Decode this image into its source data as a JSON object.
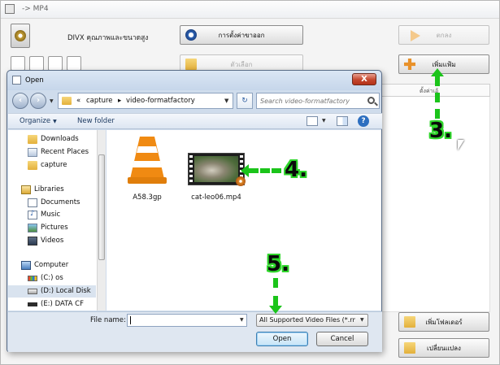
{
  "app": {
    "title": "-> MP4",
    "format_label": "DIVX คุณภาพและขนาดสูง",
    "buttons": {
      "output_settings": "การตั้งค่าขาออก",
      "ok": "ตกลง",
      "options": "ตัวเลือก",
      "add_file": "เพิ่มแฟ้ม",
      "add_folder": "เพิ่มโฟลเดอร์",
      "convert": "เปลี่ยนแปลง"
    },
    "list_header": "ตั้งค่าเอ้"
  },
  "dialog": {
    "title": "Open",
    "close_glyph": "X",
    "address": {
      "prefix": "«",
      "crumbs": [
        "capture",
        "video-formatfactory"
      ],
      "separator": "▸"
    },
    "search_placeholder": "Search video-formatfactory",
    "toolbar": {
      "organize": "Organize",
      "new_folder": "New folder"
    },
    "nav": [
      {
        "label": "Downloads",
        "icon": "folder-icon"
      },
      {
        "label": "Recent Places",
        "icon": "recent-places-icon"
      },
      {
        "label": "capture",
        "icon": "folder-icon"
      },
      {
        "label": "Libraries",
        "icon": "libraries-icon"
      },
      {
        "label": "Documents",
        "icon": "documents-icon"
      },
      {
        "label": "Music",
        "icon": "music-icon"
      },
      {
        "label": "Pictures",
        "icon": "pictures-icon"
      },
      {
        "label": "Videos",
        "icon": "videos-icon"
      },
      {
        "label": "Computer",
        "icon": "computer-icon"
      },
      {
        "label": "(C:) os",
        "icon": "drive-os-icon"
      },
      {
        "label": "(D:) Local Disk",
        "icon": "drive-icon"
      },
      {
        "label": "(E:) DATA CF",
        "icon": "sd-card-icon"
      }
    ],
    "files": [
      {
        "name": "A58.3gp",
        "icon": "vlc-cone-icon"
      },
      {
        "name": "cat-leo06.mp4",
        "icon": "video-thumbnail-icon"
      }
    ],
    "file_name_label": "File name:",
    "file_name_value": "",
    "file_type": "All Supported Video Files (*.rm;",
    "open_label": "Open",
    "cancel_label": "Cancel"
  },
  "annotations": {
    "step3": "3.",
    "step4": "4.",
    "step5": "5."
  },
  "colors": {
    "annotation_green": "#1bc41a",
    "dialog_frame": "#cfdcec",
    "close_red": "#c4462d"
  }
}
